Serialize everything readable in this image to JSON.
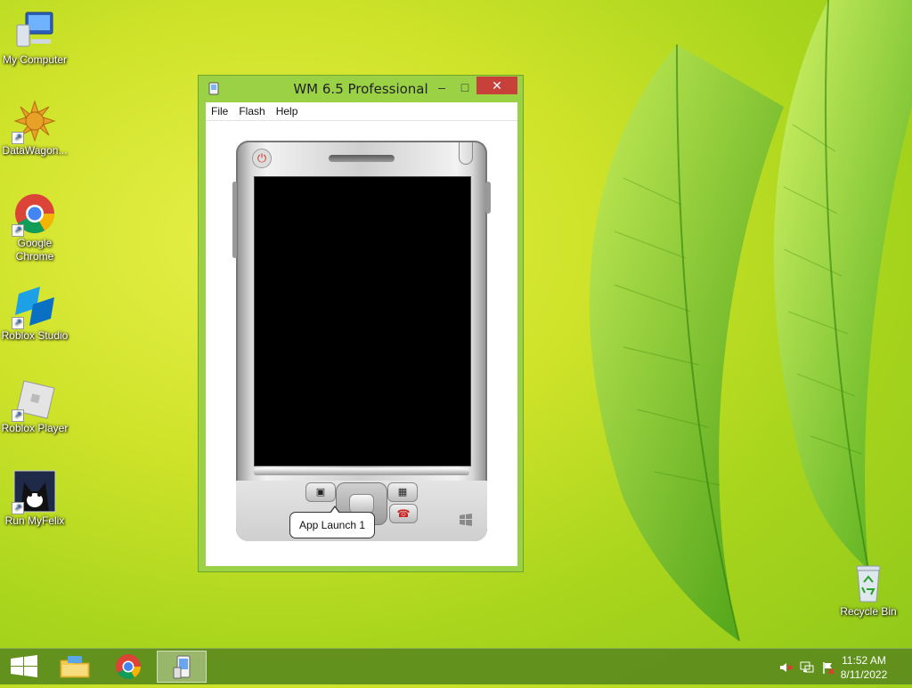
{
  "desktop": {
    "icons": [
      {
        "label": "My Computer",
        "icon": "computer-icon"
      },
      {
        "label": "DataWagon...",
        "icon": "datawagon-icon"
      },
      {
        "label": "Google Chrome",
        "icon": "chrome-icon"
      },
      {
        "label": "Roblox Studio",
        "icon": "roblox-studio-icon"
      },
      {
        "label": "Roblox Player",
        "icon": "roblox-player-icon"
      },
      {
        "label": "Run MyFelix",
        "icon": "myfelix-icon"
      }
    ],
    "recycle_bin": {
      "label": "Recycle Bin",
      "icon": "recycle-bin-icon"
    }
  },
  "window": {
    "title": "WM 6.5 Professional",
    "buttons": {
      "minimize": "–",
      "maximize": "□",
      "close": "✕"
    },
    "menu": [
      "File",
      "Flash",
      "Help"
    ],
    "tooltip": "App Launch 1"
  },
  "taskbar": {
    "items": [
      "start-icon",
      "file-explorer-icon",
      "chrome-icon",
      "emulator-icon"
    ],
    "time": "11:52 AM",
    "date": "8/11/2022"
  },
  "colors": {
    "accent": "#9bd245",
    "close": "#c7413a",
    "taskbar": "#5a871e"
  }
}
